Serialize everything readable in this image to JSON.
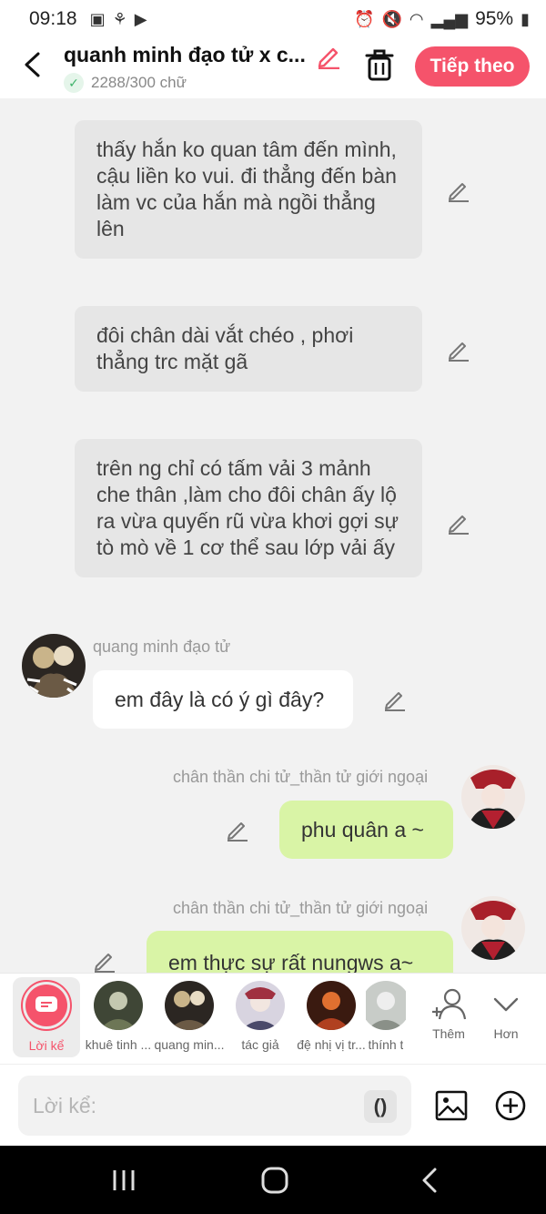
{
  "status_bar": {
    "time": "09:18",
    "battery": "95%"
  },
  "header": {
    "title": "quanh minh đạo tử x c...",
    "word_count": "2288/300 chữ",
    "next_label": "Tiếp theo"
  },
  "messages": [
    {
      "type": "narration",
      "text": "thấy hắn ko quan tâm đến mình, cậu liền ko vui. đi thẳng đến bàn làm vc của hắn mà ngồi thẳng lên"
    },
    {
      "type": "narration",
      "text": "đôi chân  dài vắt chéo , phơi thẳng trc mặt gã"
    },
    {
      "type": "narration",
      "text": "trên ng chỉ có tấm vải 3 mảnh che thân ,làm cho đôi chân ấy lộ ra vừa quyến rũ vừa khơi gợi sự tò mò về 1 cơ thể sau lớp vải ấy"
    },
    {
      "type": "left",
      "speaker": "quang minh đạo tử",
      "text": "em đây là có ý gì đây?"
    },
    {
      "type": "right",
      "speaker": "chân thần chi tử_thần tử giới ngoại",
      "text": "phu quân a ~"
    },
    {
      "type": "right",
      "speaker": "chân thần chi tử_thần tử giới ngoại",
      "text": "em thực sự rất nungws a~"
    }
  ],
  "characters": [
    {
      "label": "Lời kể",
      "selected": true
    },
    {
      "label": "khuê tinh ..."
    },
    {
      "label": "quang min..."
    },
    {
      "label": "tác giả"
    },
    {
      "label": "đệ nhị vị tr..."
    },
    {
      "label": "thính t"
    }
  ],
  "more_add_label": "Thêm",
  "more_expand_label": "Hơn",
  "input": {
    "placeholder": "Lời kể:",
    "paren_label": "()"
  },
  "colors": {
    "accent": "#f5536b",
    "bubble_right": "#d9f4a6",
    "bubble_left": "#ffffff",
    "narration": "#e6e6e6"
  }
}
